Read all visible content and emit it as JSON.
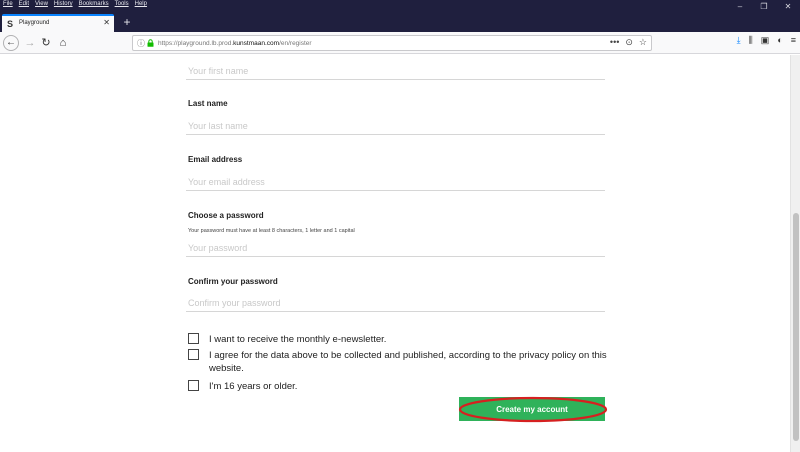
{
  "browser": {
    "menu": [
      "File",
      "Edit",
      "View",
      "History",
      "Bookmarks",
      "Tools",
      "Help"
    ],
    "window_controls": [
      "–",
      "❐",
      "✕"
    ],
    "tab": {
      "favicon": "S",
      "title": "Playground",
      "close": "✕"
    },
    "new_tab": "+",
    "nav": {
      "back": "←",
      "forward": "→",
      "reload": "↻",
      "home": "⌂"
    },
    "url": {
      "prefix": "https://playground.lb.prod.",
      "domain": "kunstmaan.com",
      "path": "/en/register",
      "info_icon": "ⓘ"
    },
    "url_actions": [
      "•••",
      "⊙",
      "☆"
    ],
    "toolbar_right": [
      "⤓",
      "⫼",
      "▣",
      "◐",
      "≡"
    ]
  },
  "form": {
    "first_name": {
      "placeholder": "Your first name"
    },
    "last_name": {
      "label": "Last name",
      "placeholder": "Your last name"
    },
    "email": {
      "label": "Email address",
      "placeholder": "Your email address"
    },
    "password": {
      "label": "Choose a password",
      "hint": "Your password must have at least 8 characters, 1 letter and 1 capital",
      "placeholder": "Your password"
    },
    "confirm_password": {
      "label": "Confirm your password",
      "placeholder": "Confirm your password"
    },
    "checkboxes": [
      {
        "label": "I want to receive the monthly e-newsletter.",
        "checked": false
      },
      {
        "label": "I agree for the data above to be collected and published, according to the privacy policy on this website.",
        "checked": false
      },
      {
        "label": "I'm 16 years or older.",
        "checked": false
      }
    ],
    "submit_label": "Create my account"
  },
  "colors": {
    "titlebar": "#1f1f3e",
    "submit_bg": "#2fb25a",
    "annotation": "#d62020",
    "link_blue": "#0a84ff"
  }
}
